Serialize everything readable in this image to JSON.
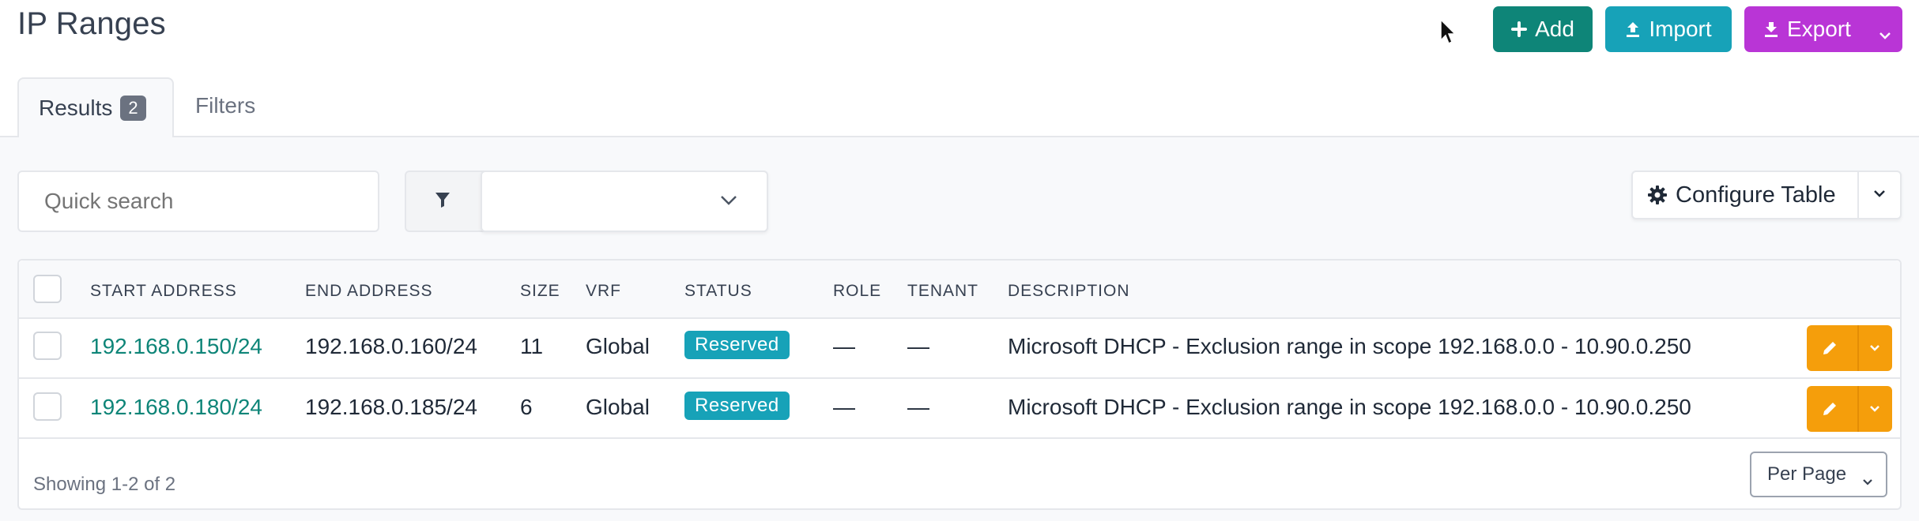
{
  "page": {
    "title": "IP Ranges"
  },
  "actions": {
    "add_label": "Add",
    "import_label": "Import",
    "export_label": "Export"
  },
  "tabs": {
    "results_label": "Results",
    "results_count": "2",
    "filters_label": "Filters"
  },
  "toolbar": {
    "search_placeholder": "Quick search",
    "filter_value": "",
    "configure_label": "Configure Table"
  },
  "table": {
    "columns": [
      "START ADDRESS",
      "END ADDRESS",
      "SIZE",
      "VRF",
      "STATUS",
      "ROLE",
      "TENANT",
      "DESCRIPTION"
    ],
    "rows": [
      {
        "start": "192.168.0.150/24",
        "end": "192.168.0.160/24",
        "size": "11",
        "vrf": "Global",
        "status": "Reserved",
        "role": "—",
        "tenant": "—",
        "description": "Microsoft DHCP - Exclusion range in scope 192.168.0.0 - 10.90.0.250"
      },
      {
        "start": "192.168.0.180/24",
        "end": "192.168.0.185/24",
        "size": "6",
        "vrf": "Global",
        "status": "Reserved",
        "role": "—",
        "tenant": "—",
        "description": "Microsoft DHCP - Exclusion range in scope 192.168.0.0 - 10.90.0.250"
      }
    ]
  },
  "footer": {
    "showing": "Showing 1-2 of 2",
    "per_page_label": "Per Page"
  },
  "colors": {
    "add": "#0e8578",
    "import": "#17a2b8",
    "export": "#b935d6",
    "status_reserved": "#17a2b8",
    "row_action": "#f59e0b",
    "link": "#0e8578"
  }
}
